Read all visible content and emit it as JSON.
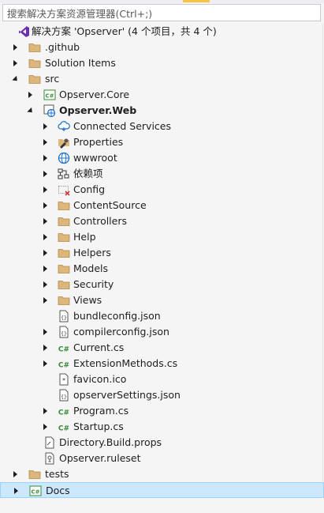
{
  "search": {
    "placeholder": "搜索解决方案资源管理器(Ctrl+;)"
  },
  "tree": [
    {
      "label": "解决方案 'Opserver' (4 个项目，共 4 个)",
      "icon": "vs-solution-icon",
      "level": 0,
      "expander": "none",
      "bold": false
    },
    {
      "label": ".github",
      "icon": "folder-icon",
      "level": 1,
      "expander": "collapsed",
      "bold": false
    },
    {
      "label": "Solution Items",
      "icon": "folder-icon",
      "level": 1,
      "expander": "collapsed",
      "bold": false
    },
    {
      "label": "src",
      "icon": "folder-icon",
      "level": 1,
      "expander": "expanded",
      "bold": false
    },
    {
      "label": "Opserver.Core",
      "icon": "csharp-project-icon",
      "level": 2,
      "expander": "collapsed",
      "bold": false
    },
    {
      "label": "Opserver.Web",
      "icon": "web-project-icon",
      "level": 2,
      "expander": "expanded",
      "bold": true
    },
    {
      "label": "Connected Services",
      "icon": "connected-services-icon",
      "level": 3,
      "expander": "collapsed",
      "bold": false
    },
    {
      "label": "Properties",
      "icon": "properties-icon",
      "level": 3,
      "expander": "collapsed",
      "bold": false
    },
    {
      "label": "wwwroot",
      "icon": "globe-icon",
      "level": 3,
      "expander": "collapsed",
      "bold": false
    },
    {
      "label": "依赖项",
      "icon": "dependencies-icon",
      "level": 3,
      "expander": "collapsed",
      "bold": false
    },
    {
      "label": "Config",
      "icon": "excluded-folder-icon",
      "level": 3,
      "expander": "collapsed",
      "bold": false
    },
    {
      "label": "ContentSource",
      "icon": "folder-icon",
      "level": 3,
      "expander": "collapsed",
      "bold": false
    },
    {
      "label": "Controllers",
      "icon": "folder-icon",
      "level": 3,
      "expander": "collapsed",
      "bold": false
    },
    {
      "label": "Help",
      "icon": "folder-icon",
      "level": 3,
      "expander": "collapsed",
      "bold": false
    },
    {
      "label": "Helpers",
      "icon": "folder-icon",
      "level": 3,
      "expander": "collapsed",
      "bold": false
    },
    {
      "label": "Models",
      "icon": "folder-icon",
      "level": 3,
      "expander": "collapsed",
      "bold": false
    },
    {
      "label": "Security",
      "icon": "folder-icon",
      "level": 3,
      "expander": "collapsed",
      "bold": false
    },
    {
      "label": "Views",
      "icon": "folder-icon",
      "level": 3,
      "expander": "collapsed",
      "bold": false
    },
    {
      "label": "bundleconfig.json",
      "icon": "json-file-icon",
      "level": 3,
      "expander": "none",
      "bold": false
    },
    {
      "label": "compilerconfig.json",
      "icon": "json-file-icon",
      "level": 3,
      "expander": "collapsed",
      "bold": false
    },
    {
      "label": "Current.cs",
      "icon": "csharp-file-icon",
      "level": 3,
      "expander": "collapsed",
      "bold": false
    },
    {
      "label": "ExtensionMethods.cs",
      "icon": "csharp-file-icon",
      "level": 3,
      "expander": "collapsed",
      "bold": false
    },
    {
      "label": "favicon.ico",
      "icon": "ico-file-icon",
      "level": 3,
      "expander": "none",
      "bold": false
    },
    {
      "label": "opserverSettings.json",
      "icon": "json-file-icon",
      "level": 3,
      "expander": "none",
      "bold": false
    },
    {
      "label": "Program.cs",
      "icon": "csharp-file-icon",
      "level": 3,
      "expander": "collapsed",
      "bold": false
    },
    {
      "label": "Startup.cs",
      "icon": "csharp-file-icon",
      "level": 3,
      "expander": "collapsed",
      "bold": false
    },
    {
      "label": "Directory.Build.props",
      "icon": "props-file-icon",
      "level": 2,
      "expander": "none",
      "bold": false
    },
    {
      "label": "Opserver.ruleset",
      "icon": "ruleset-file-icon",
      "level": 2,
      "expander": "none",
      "bold": false
    },
    {
      "label": "tests",
      "icon": "folder-icon",
      "level": 1,
      "expander": "collapsed",
      "bold": false
    },
    {
      "label": "Docs",
      "icon": "csharp-project-icon",
      "level": 1,
      "expander": "collapsed",
      "bold": false,
      "selected": true
    }
  ]
}
